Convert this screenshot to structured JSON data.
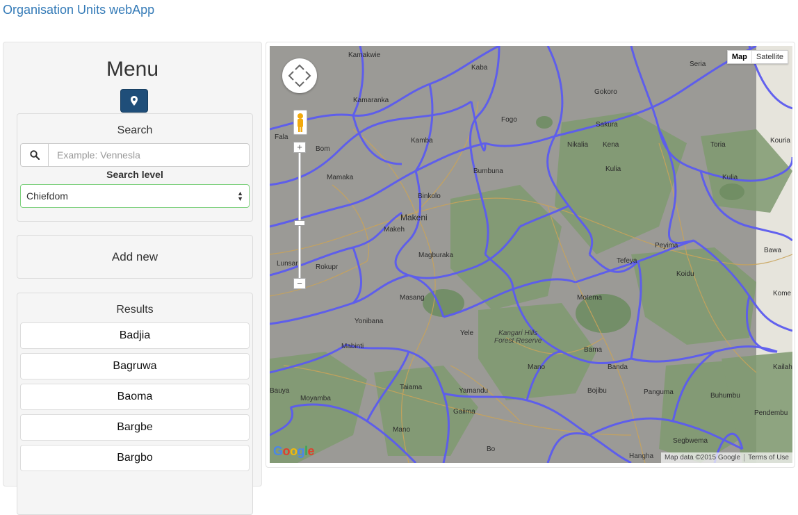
{
  "header": {
    "app_title": "Organisation Units webApp"
  },
  "sidebar": {
    "title": "Menu",
    "search": {
      "heading": "Search",
      "placeholder": "Example: Vennesla",
      "level_label": "Search level",
      "level_value": "Chiefdom"
    },
    "add_new_label": "Add new",
    "results": {
      "heading": "Results",
      "items": [
        "Badjia",
        "Bagruwa",
        "Baoma",
        "Bargbe",
        "Bargbo"
      ]
    }
  },
  "map": {
    "type_controls": {
      "map_label": "Map",
      "satellite_label": "Satellite"
    },
    "zoom_in": "+",
    "zoom_out": "−",
    "logo": "Google",
    "attribution": {
      "data": "Map data ©2015 Google",
      "terms": "Terms of Use"
    },
    "region_label": "Kangari Hills\nForest Reserve",
    "places": [
      "Kamakwie",
      "Kaba",
      "Seria",
      "Gokoro",
      "Kamaranka",
      "Fogo",
      "Sakura",
      "Fala",
      "Bom",
      "Kamba",
      "Nikalia",
      "Kena",
      "Toria",
      "Kouria",
      "Bumbuna",
      "Kulia",
      "Mamaka",
      "Kulia",
      "Binkolo",
      "Makeni",
      "Makeh",
      "Magburaka",
      "Peyima",
      "Bawa",
      "Lunsar",
      "Rokupr",
      "Tefeya",
      "Koidu",
      "Masang",
      "Motema",
      "Kome",
      "Yonibana",
      "Yele",
      "Mabinti",
      "Kangari Hills",
      "Bama",
      "Mano",
      "Banda",
      "Kailahu",
      "Taiama",
      "Yamandu",
      "Bojibu",
      "Panguma",
      "Buhumbu",
      "Bauya",
      "Moyamba",
      "Gaiima",
      "Pendembu",
      "Mano",
      "Segbwema",
      "Bo"
    ],
    "hangha": "Hangha",
    "colors": {
      "border": "#5b5bf0",
      "road": "#c9a35a",
      "land": "#9b9a96",
      "forest": "#7e9a6d"
    }
  }
}
